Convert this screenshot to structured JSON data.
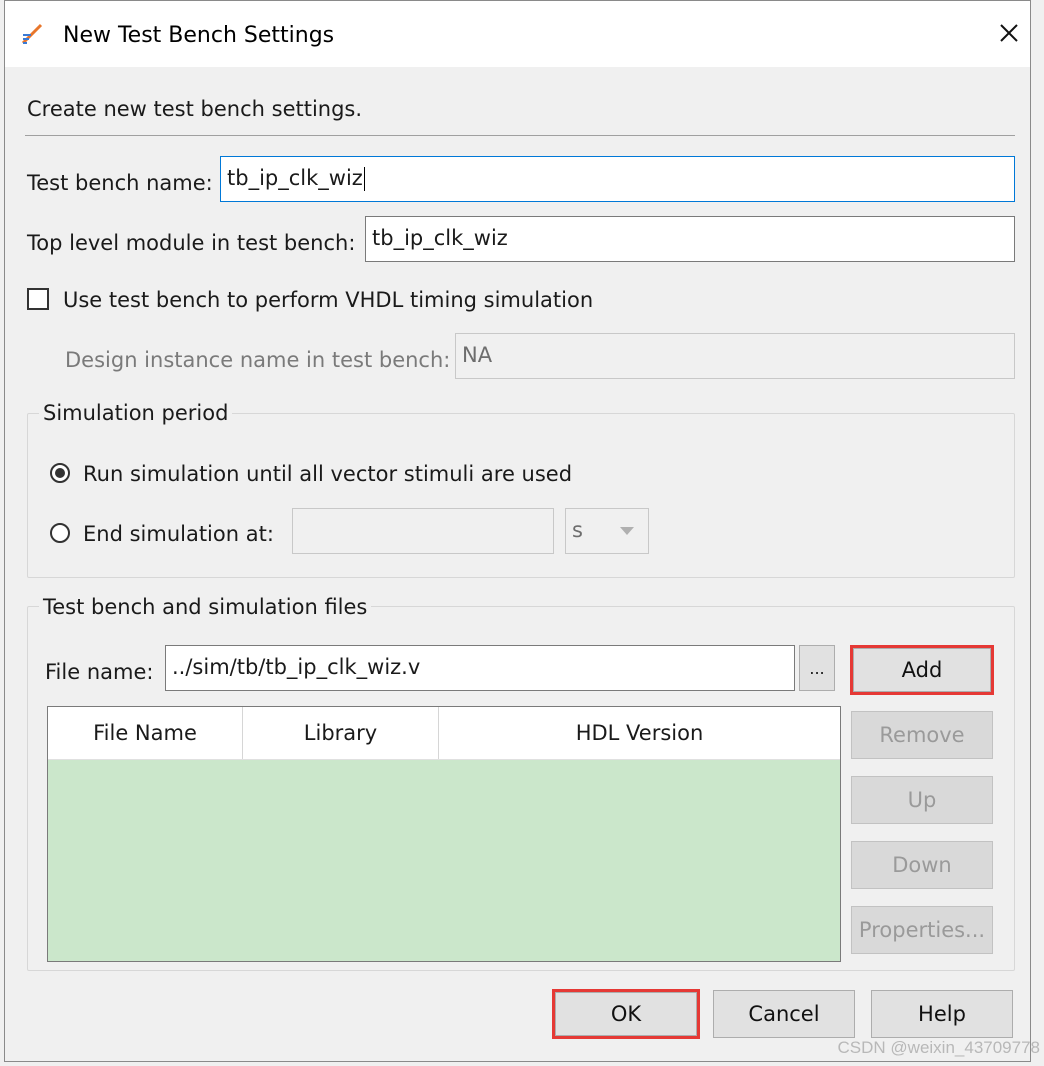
{
  "dialog": {
    "title": "New Test Bench Settings",
    "description": "Create new test bench settings."
  },
  "form": {
    "test_bench_name_label": "Test bench name:",
    "test_bench_name_value": "tb_ip_clk_wiz",
    "top_level_label": "Top level module in test bench:",
    "top_level_value": "tb_ip_clk_wiz",
    "vhdl_timing_label": "Use test bench to perform VHDL timing simulation",
    "vhdl_timing_checked": false,
    "design_instance_label": "Design instance name in test bench:",
    "design_instance_value": "NA"
  },
  "simulation_period": {
    "title": "Simulation period",
    "option_all_vectors": "Run simulation until all vector stimuli are used",
    "option_end_at": "End simulation at:",
    "end_at_value": "",
    "unit_value": "s",
    "selected": "all_vectors"
  },
  "files": {
    "title": "Test bench and simulation files",
    "file_name_label": "File name:",
    "file_name_value": "../sim/tb/tb_ip_clk_wiz.v",
    "browse_label": "...",
    "columns": [
      "File Name",
      "Library",
      "HDL Version"
    ],
    "rows": [],
    "buttons": {
      "add": "Add",
      "remove": "Remove",
      "up": "Up",
      "down": "Down",
      "properties": "Properties..."
    }
  },
  "footer": {
    "ok": "OK",
    "cancel": "Cancel",
    "help": "Help"
  },
  "watermark": "CSDN @weixin_43709778",
  "colors": {
    "highlight": "#e53935",
    "table_body": "#cbe7cb",
    "focus_border": "#0078d7"
  },
  "icons": {
    "title_icon": "edit-pencil-icon",
    "close": "close-icon",
    "dropdown": "chevron-down-icon"
  }
}
